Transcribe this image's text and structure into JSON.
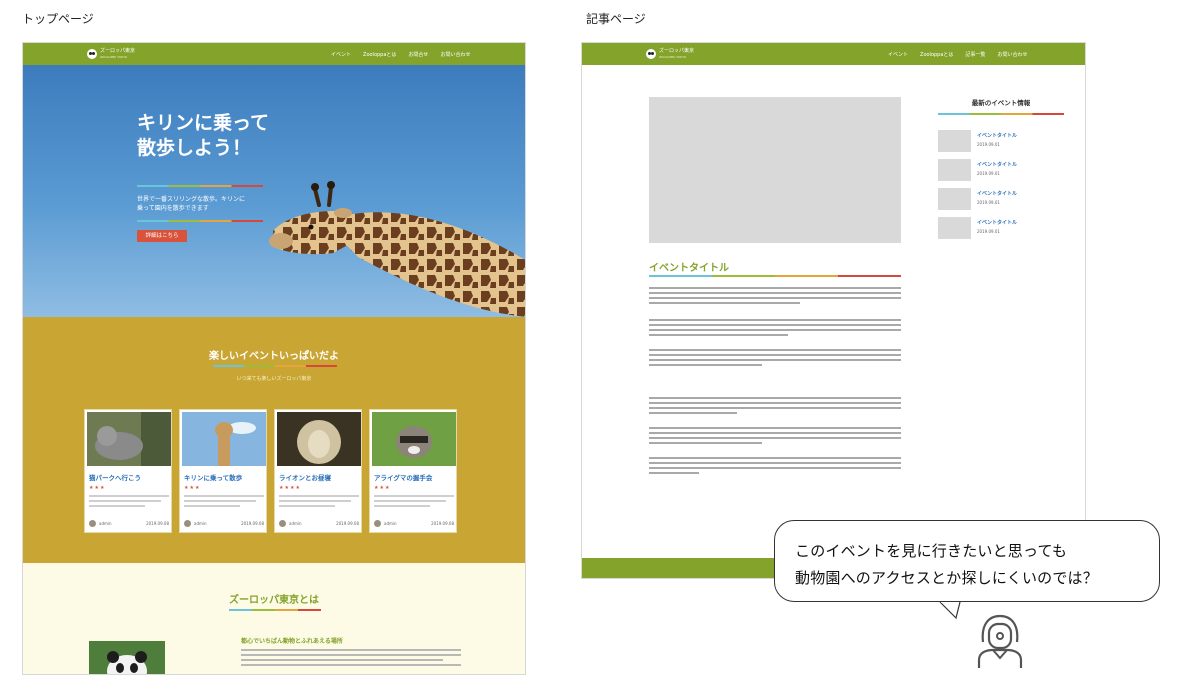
{
  "labels": {
    "top_page": "トップページ",
    "article_page": "記事ページ"
  },
  "site": {
    "name": "ズーロッパ東京",
    "nav": [
      "イベント",
      "Zooloppaとは",
      "お問合せ",
      "お問い合わせ"
    ]
  },
  "hero": {
    "title_line1": "キリンに乗って",
    "title_line2": "散歩しよう！",
    "text_line1": "世界で一番スリリングな散歩。キリンに",
    "text_line2": "乗って園内を散歩できます",
    "button": "詳細はこちら"
  },
  "events": {
    "title": "楽しいイベントいっぱいだよ",
    "subtitle": "いつ来ても楽しいズーロッパ東京",
    "cards": [
      {
        "title": "猫パークへ行こう",
        "stars": "★★★"
      },
      {
        "title": "キリンに乗って散歩",
        "stars": "★★★"
      },
      {
        "title": "ライオンとお昼寝",
        "stars": "★★★★"
      },
      {
        "title": "アライグマの握手会",
        "stars": "★★★"
      }
    ]
  },
  "about": {
    "title": "ズーロッパ東京とは",
    "subhead": "都心でいちばん動物とふれあえる場所"
  },
  "article": {
    "nav": [
      "イベント",
      "Zooloppaとは",
      "記事一覧",
      "お問い合わせ"
    ],
    "title": "イベントタイトル",
    "sidebar_title": "最新のイベント情報",
    "sidebar_items": [
      {
        "name": "イベントタイトル"
      },
      {
        "name": "イベントタイトル"
      },
      {
        "name": "イベントタイトル"
      },
      {
        "name": "イベントタイトル"
      }
    ]
  },
  "bubble": {
    "line1": "このイベントを見に行きたいと思っても",
    "line2": "動物園へのアクセスとか探しにくいのでは？"
  },
  "colors": {
    "green": "#84a32a",
    "mustard": "#c9a534",
    "orange": "#d9533a",
    "link_blue": "#2a6fb7"
  },
  "icons": [
    "panda-logo-icon",
    "person-icon"
  ]
}
